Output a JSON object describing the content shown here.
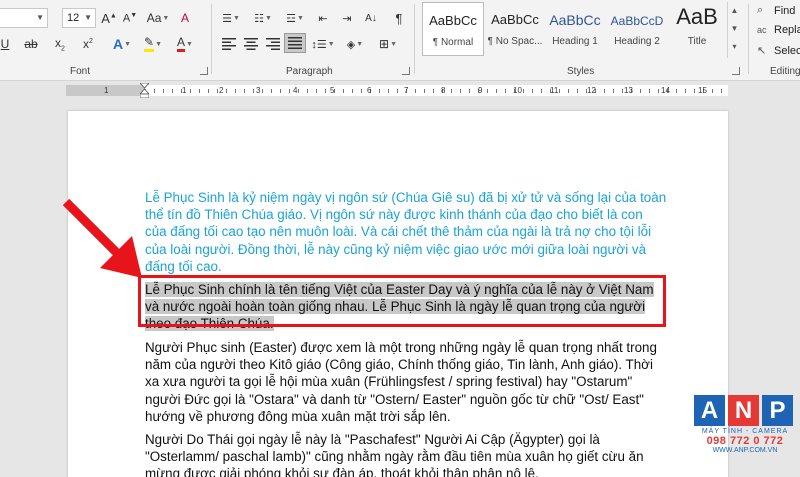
{
  "font": {
    "size_value": "12",
    "group_label": "Font"
  },
  "paragraph": {
    "group_label": "Paragraph"
  },
  "styles": {
    "group_label": "Styles",
    "items": [
      {
        "preview": "AaBbCc",
        "name": "¶ Normal"
      },
      {
        "preview": "AaBbCc",
        "name": "¶ No Spac..."
      },
      {
        "preview": "AaBbCc",
        "name": "Heading 1"
      },
      {
        "preview": "AaBbCcD",
        "name": "Heading 2"
      },
      {
        "preview": "AaB",
        "name": "Title"
      }
    ]
  },
  "editing": {
    "group_label": "Editing",
    "find": "Find",
    "replace": "Repla",
    "select": "Select"
  },
  "ruler": {
    "numbers": [
      "1",
      "1",
      "2",
      "3",
      "4",
      "5",
      "6",
      "7",
      "8",
      "9",
      "10",
      "11",
      "12",
      "13",
      "14",
      "15"
    ]
  },
  "colors": {
    "blue_text": "#1aa3d9",
    "highlight_box": "#e8141b",
    "arrow": "#e8141b"
  },
  "document": {
    "p1": "Lễ Phục Sinh là kỷ niệm ngày vị ngôn sứ (Chúa Giê su) đã bị xử tử và sống lại của toàn thể tín đồ Thiên Chúa giáo. Vị ngôn sứ này được kinh thánh của đạo cho biết là con của đấng tối cao tạo nên muôn loài. Và cái chết thê thảm của ngài là trả nợ cho tội lỗi của loài người. Đồng thời, lễ này cũng kỷ niệm việc giao ước mới giữa loài người và đấng tối cao.",
    "p2": "Lễ Phục Sinh chính là tên tiếng Việt của Easter Day và ý nghĩa của lễ này ở Việt Nam và nước ngoài hoàn toàn giống nhau. Lễ Phục Sinh là ngày lễ quan trọng của người theo đạo Thiên Chúa.",
    "p3": "Người Phục sinh (Easter) được xem là một trong những ngày lễ quan trọng nhất trong năm của người theo Kitô giáo (Công giáo, Chính thống giáo, Tin lành, Anh giáo). Thời xa xưa người ta gọi lễ hội mùa xuân (Frühlingsfest / spring festival) hay \"Ostarum\" người Đức gọi là \"Ostara\" và danh từ \"Ostern/ Easter\" nguồn gốc từ chữ \"Ost/ East\" hướng về phương đông mùa xuân mặt trời sắp lên.",
    "p4": "Người Do Thái gọi ngày lễ này là \"Paschafest\" Người Ai Cập (Ägypter) gọi là \"Osterlamm/ paschal lamb)\" cũng nhằm ngày rằm đầu tiên mùa xuân họ giết cừu ăn mừng được giải phóng khỏi sự đàn áp, thoát khỏi thân phận nô lệ."
  },
  "watermark": {
    "letters": [
      "A",
      "N",
      "P"
    ],
    "tagline": "MÁY TÍNH - CAMERA",
    "phone": "098 772 0 772",
    "website": "WWW.ANP.COM.VN"
  }
}
